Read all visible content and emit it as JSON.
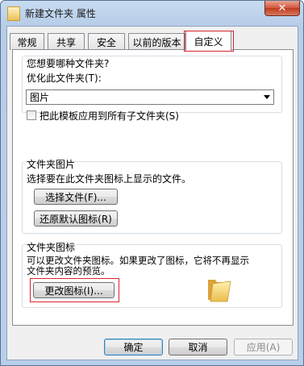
{
  "window": {
    "title": "新建文件夹 属性",
    "close_glyph": "✕"
  },
  "tabs": [
    {
      "label": "常规"
    },
    {
      "label": "共享"
    },
    {
      "label": "安全"
    },
    {
      "label": "以前的版本"
    },
    {
      "label": "自定义",
      "active": true
    }
  ],
  "folder_type": {
    "heading": "您想要哪种文件夹?",
    "optimize_label": "优化此文件夹(T):",
    "selected_value": "图片",
    "apply_checkbox_label": "把此模板应用到所有子文件夹(S)",
    "apply_checked": false
  },
  "folder_picture": {
    "heading": "文件夹图片",
    "description": "选择要在此文件夹图标上显示的文件。",
    "choose_file_button": "选择文件(F)...",
    "restore_default_button": "还原默认图标(R)"
  },
  "folder_icon": {
    "heading": "文件夹图标",
    "description_line1": "可以更改文件夹图标。如果更改了图标，它将不再显示",
    "description_line2": "文件夹内容的预览。",
    "change_icon_button": "更改图标(I)...",
    "preview_icon": "folder-icon"
  },
  "footer": {
    "ok_button": "确定",
    "cancel_button": "取消",
    "apply_button": "应用(A)"
  },
  "colors": {
    "highlight_red": "#d9262c",
    "window_frame": "#b9cfe9"
  }
}
